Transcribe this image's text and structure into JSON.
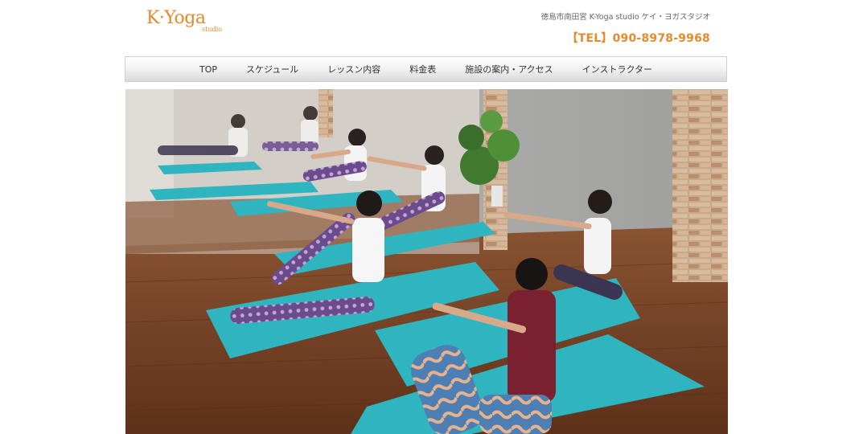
{
  "header": {
    "logo_main": "K·Yoga",
    "logo_sub": "studio",
    "tagline": "徳島市南田宮 K-Yoga studio ケイ・ヨガスタジオ",
    "tel": "【TEL】090-8978-9968"
  },
  "nav": {
    "items": [
      {
        "label": "TOP"
      },
      {
        "label": "スケジュール"
      },
      {
        "label": "レッスン内容"
      },
      {
        "label": "料金表"
      },
      {
        "label": "施設の案内・アクセス"
      },
      {
        "label": "インストラクター"
      }
    ]
  },
  "colors": {
    "accent": "#e58b2b",
    "mat": "#2fb5bf",
    "floor": "#7a4526"
  }
}
